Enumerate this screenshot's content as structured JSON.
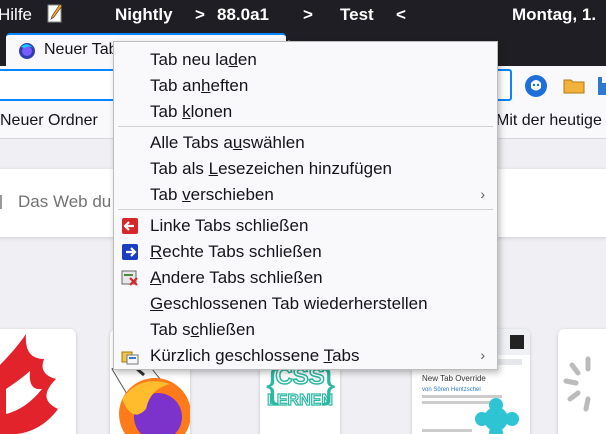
{
  "window": {
    "menu_hilfe": "Hilfe",
    "title_segments": [
      "Nightly",
      ">",
      "88.0a1",
      ">",
      "Test",
      "<",
      "Montag, 1."
    ]
  },
  "tab": {
    "title": "Neuer Tab"
  },
  "navbar": {
    "icons": [
      "github-icon",
      "folder-icon",
      "save-icon"
    ]
  },
  "bookmarks": {
    "left": "Neuer Ordner",
    "right": "Mit der heutige"
  },
  "search": {
    "placeholder": "Das Web du"
  },
  "tiles": [
    "tile-1",
    "firefox-tile",
    "css-lernen-tile",
    "new-tab-override-tile",
    "loading-tile"
  ],
  "tile_text": {
    "css_line1": "CSS",
    "css_line2": "LERNEN",
    "override_title": "New Tab Override",
    "override_author": "von Sören Hentzschel"
  },
  "context_menu": {
    "reload": {
      "pre": "Tab neu la",
      "u": "d",
      "post": "en"
    },
    "pin": {
      "pre": "Tab an",
      "u": "h",
      "post": "eften"
    },
    "duplicate": {
      "pre": "Tab ",
      "u": "k",
      "post": "lonen"
    },
    "select_all": {
      "pre": "Alle Tabs a",
      "u": "u",
      "post": "swählen"
    },
    "bookmark": {
      "pre": "Tab als ",
      "u": "L",
      "post": "esezeichen hinzufügen"
    },
    "move": {
      "pre": "Tab ",
      "u": "v",
      "post": "erschieben"
    },
    "close_left": {
      "pre": "Linke Tabs schließen",
      "u": "",
      "post": ""
    },
    "close_right": {
      "pre": "",
      "u": "R",
      "post": "echte Tabs schließen"
    },
    "close_others": {
      "pre": "",
      "u": "A",
      "post": "ndere Tabs schließen"
    },
    "restore": {
      "pre": "",
      "u": "G",
      "post": "eschlossenen Tab wiederherstellen"
    },
    "close": {
      "pre": "Tab s",
      "u": "c",
      "post": "hließen"
    },
    "recently_closed": {
      "pre": "Kürzlich geschlossene ",
      "u": "T",
      "post": "abs"
    },
    "submenu_arrow": "›"
  }
}
